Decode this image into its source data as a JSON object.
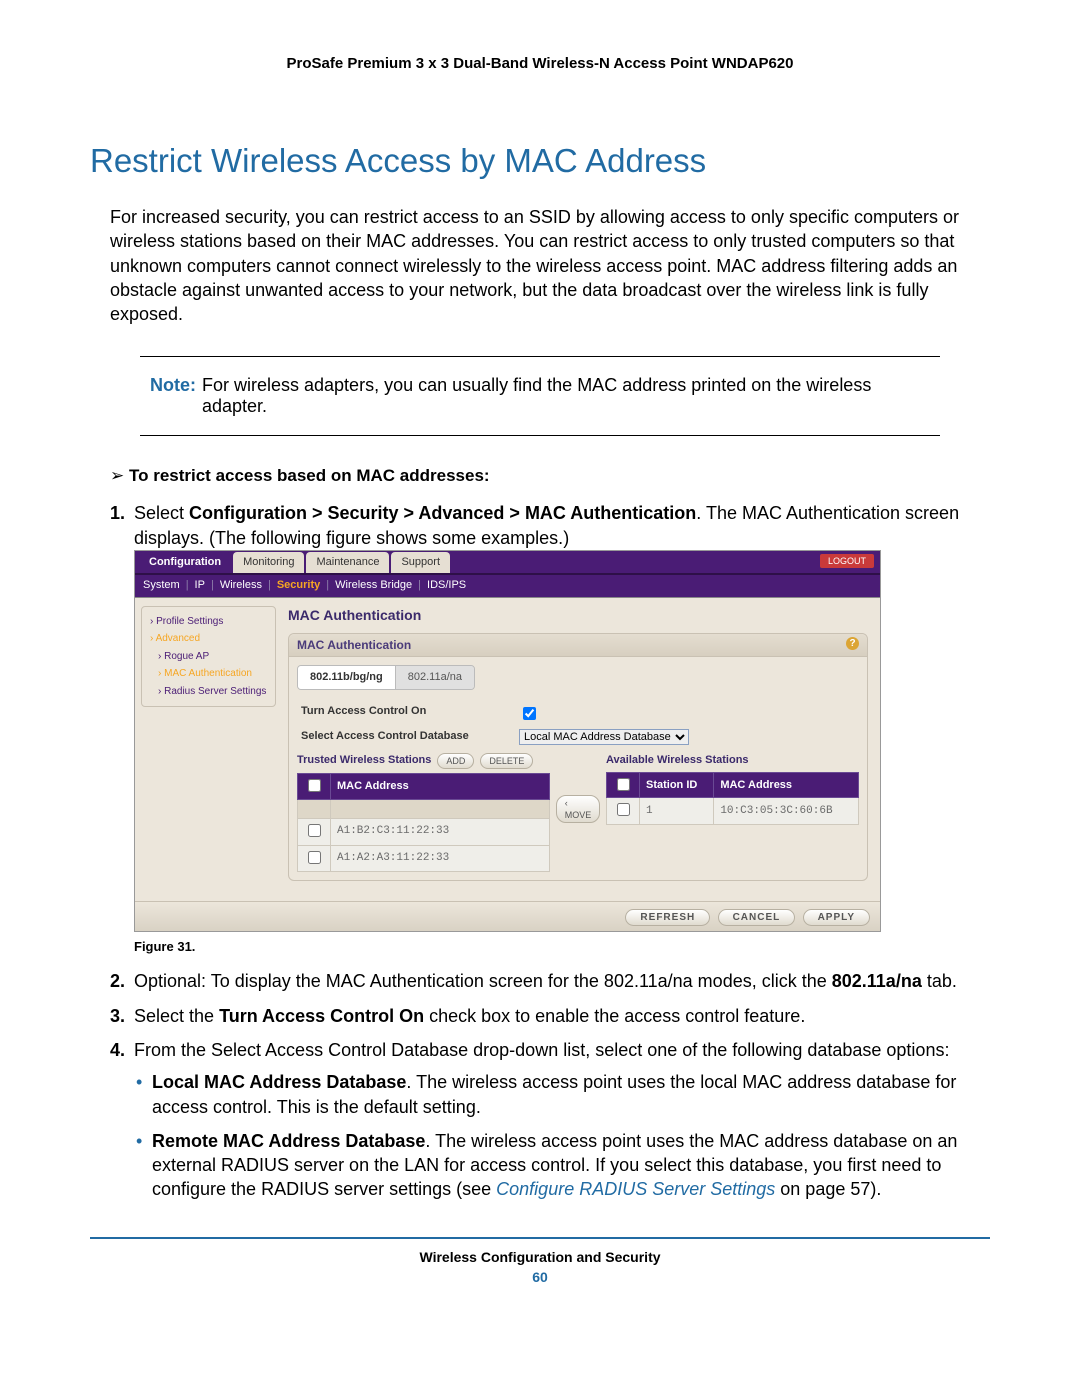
{
  "header": {
    "product": "ProSafe Premium 3 x 3 Dual-Band Wireless-N Access Point WNDAP620"
  },
  "section": {
    "title": "Restrict Wireless Access by MAC Address",
    "intro": "For increased security, you can restrict access to an SSID by allowing access to only specific computers or wireless stations based on their MAC addresses. You can restrict access to only trusted computers so that unknown computers cannot connect wirelessly to the wireless access point. MAC address filtering adds an obstacle against unwanted access to your network, but the data broadcast over the wireless link is fully exposed."
  },
  "note": {
    "label": "Note:",
    "text": "For wireless adapters, you can usually find the MAC address printed on the wireless adapter."
  },
  "task": {
    "title": "To restrict access based on MAC addresses:",
    "step1_a": "Select ",
    "step1_b": "Configuration > Security > Advanced > MAC Authentication",
    "step1_c": ". The MAC Authentication screen displays. (The following figure shows some examples.)",
    "step2_a": "Optional: To display the MAC Authentication screen for the 802.11a/na modes, click the ",
    "step2_b": "802.11a/na",
    "step2_c": " tab.",
    "step3_a": "Select the ",
    "step3_b": "Turn Access Control On",
    "step3_c": " check box to enable the access control feature.",
    "step4": "From the Select Access Control Database drop-down list, select one of the following database options:",
    "bullet1_b": "Local MAC Address Database",
    "bullet1_t": ". The wireless access point uses the local MAC address database for access control. This is the default setting.",
    "bullet2_b": "Remote MAC Address Database",
    "bullet2_t": ". The wireless access point uses the MAC address database on an external RADIUS server on the LAN for access control. If you select this database, you first need to configure the RADIUS server settings (see ",
    "bullet2_link": "Configure RADIUS Server Settings",
    "bullet2_tail": " on page 57)."
  },
  "figure": {
    "caption": "Figure 31."
  },
  "shot": {
    "tabs": [
      "Configuration",
      "Monitoring",
      "Maintenance",
      "Support"
    ],
    "logout": "LOGOUT",
    "subtabs": [
      "System",
      "IP",
      "Wireless",
      "Security",
      "Wireless Bridge",
      "IDS/IPS"
    ],
    "subtab_active_index": 3,
    "sidebar": [
      {
        "label": "Profile Settings",
        "active": false,
        "sub": false
      },
      {
        "label": "Advanced",
        "active": true,
        "sub": false
      },
      {
        "label": "Rogue AP",
        "active": false,
        "sub": true
      },
      {
        "label": "MAC Authentication",
        "active": true,
        "sub": true
      },
      {
        "label": "Radius Server Settings",
        "active": false,
        "sub": true
      }
    ],
    "panel_title": "MAC Authentication",
    "panel_head": "MAC Authentication",
    "radio_tabs": [
      "802.11b/bg/ng",
      "802.11a/na"
    ],
    "row1": "Turn Access Control On",
    "row2": "Select Access Control Database",
    "db_value": "Local MAC Address Database",
    "trusted_title": "Trusted Wireless Stations",
    "avail_title": "Available Wireless Stations",
    "btn_add": "ADD",
    "btn_delete": "DELETE",
    "btn_move": "MOVE",
    "col_mac": "MAC Address",
    "col_station": "Station ID",
    "trusted_rows": [
      "A1:B2:C3:11:22:33",
      "A1:A2:A3:11:22:33"
    ],
    "avail_rows": [
      {
        "id": "1",
        "mac": "10:C3:05:3C:60:6B"
      }
    ],
    "footer_buttons": [
      "REFRESH",
      "CANCEL",
      "APPLY"
    ]
  },
  "footer": {
    "text": "Wireless Configuration and Security",
    "page": "60"
  }
}
